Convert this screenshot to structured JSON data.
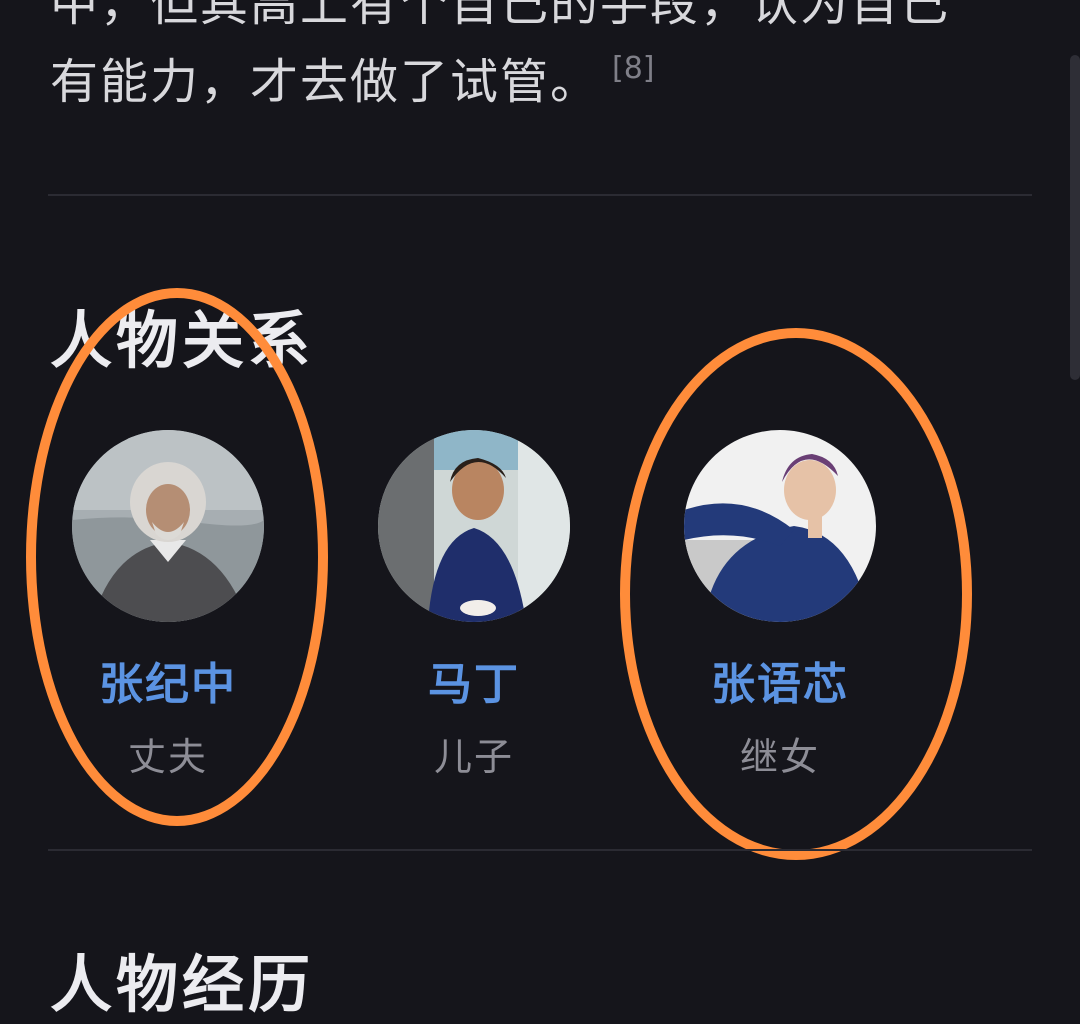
{
  "article": {
    "clipped_line": "中，但其高上有个自己的手段，认为自己",
    "intro_line": "有能力，才去做了试管。",
    "citation": "[8]"
  },
  "relations_section": {
    "title": "人物关系",
    "people": [
      {
        "name": "张纪中",
        "relation": "丈夫"
      },
      {
        "name": "马丁",
        "relation": "儿子"
      },
      {
        "name": "张语芯",
        "relation": "继女"
      }
    ]
  },
  "next_section": {
    "title": "人物经历"
  },
  "colors": {
    "background": "#15151b",
    "name_link": "#5b93e2",
    "highlight_ring": "#ff8c3a"
  }
}
